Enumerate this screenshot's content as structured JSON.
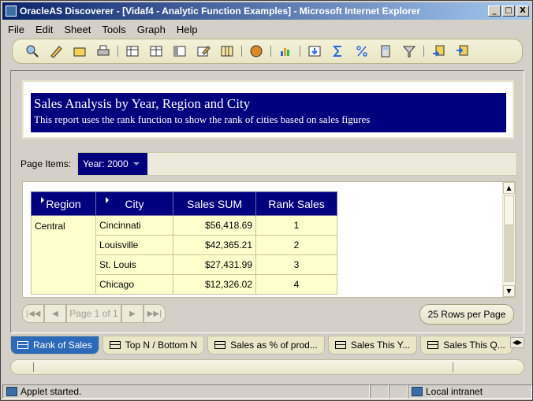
{
  "window": {
    "title": "OracleAS Discoverer - [Vidaf4 - Analytic Function Examples] - Microsoft Internet Explorer",
    "controls": [
      "_",
      "□",
      "X"
    ]
  },
  "menu": [
    "File",
    "Edit",
    "Sheet",
    "Tools",
    "Graph",
    "Help"
  ],
  "toolbar": {
    "icons": [
      "search-icon",
      "edit-icon",
      "open-icon",
      "print-icon",
      "sep",
      "table-grid-icon",
      "table-icon",
      "crosstab-icon",
      "edit-sheet-icon",
      "columns-icon",
      "sep",
      "format-icon",
      "sep",
      "graph-icon",
      "sep",
      "drill-icon",
      "sum-icon",
      "percent-icon",
      "calculator-icon",
      "filter-icon",
      "sep",
      "export-icon",
      "import-icon"
    ]
  },
  "report": {
    "title": "Sales Analysis by Year, Region and City",
    "subtitle": "This report uses the rank function to show the rank of cities based on sales figures"
  },
  "page_items": {
    "label": "Page Items:",
    "year_label": "Year:",
    "year_value": "2000"
  },
  "table": {
    "headers": [
      "Region",
      "City",
      "Sales SUM",
      "Rank Sales"
    ],
    "region": "Central",
    "rows": [
      {
        "city": "Cincinnati",
        "sales": "$56,418.69",
        "rank": "1"
      },
      {
        "city": "Louisville",
        "sales": "$42,365.21",
        "rank": "2"
      },
      {
        "city": "St. Louis",
        "sales": "$27,431.99",
        "rank": "3"
      },
      {
        "city": "Chicago",
        "sales": "$12,326.02",
        "rank": "4"
      }
    ]
  },
  "pager": {
    "page_label": "Page 1 of 1",
    "rows_per_page": "25 Rows per Page"
  },
  "tabs": [
    {
      "label": "Rank of Sales",
      "active": true
    },
    {
      "label": "Top N / Bottom N",
      "active": false
    },
    {
      "label": "Sales as % of prod...",
      "active": false
    },
    {
      "label": "Sales This Y...",
      "active": false
    },
    {
      "label": "Sales This Q...",
      "active": false
    }
  ],
  "status": {
    "message": "Applet started.",
    "zone": "Local intranet"
  },
  "colors": {
    "title_bg": "#00007f",
    "active_tab": "#2b6ab8",
    "cell_bg": "#ffffcc"
  }
}
